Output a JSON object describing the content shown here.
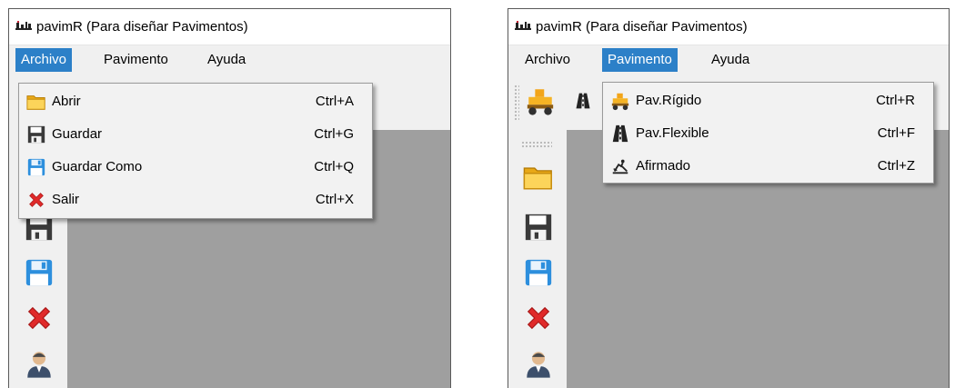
{
  "left_window": {
    "title": "pavimR (Para diseñar Pavimentos)",
    "menus": [
      {
        "label": "Archivo",
        "active": true
      },
      {
        "label": "Pavimento",
        "active": false
      },
      {
        "label": "Ayuda",
        "active": false
      }
    ],
    "dropdown": [
      {
        "label": "Abrir",
        "shortcut": "Ctrl+A",
        "icon": "folder-icon"
      },
      {
        "label": "Guardar",
        "shortcut": "Ctrl+G",
        "icon": "save-icon"
      },
      {
        "label": "Guardar Como",
        "shortcut": "Ctrl+Q",
        "icon": "save-as-icon"
      },
      {
        "label": "Salir",
        "shortcut": "Ctrl+X",
        "icon": "exit-icon"
      }
    ],
    "vertical_toolbar": [
      "save-icon",
      "save-as-icon",
      "exit-icon",
      "user-icon"
    ]
  },
  "right_window": {
    "title": "pavimR (Para diseñar Pavimentos)",
    "menus": [
      {
        "label": "Archivo",
        "active": false
      },
      {
        "label": "Pavimento",
        "active": true
      },
      {
        "label": "Ayuda",
        "active": false
      }
    ],
    "dropdown": [
      {
        "label": "Pav.Rígido",
        "shortcut": "Ctrl+R",
        "icon": "rigid-pavement-icon"
      },
      {
        "label": "Pav.Flexible",
        "shortcut": "Ctrl+F",
        "icon": "flexible-pavement-icon"
      },
      {
        "label": "Afirmado",
        "shortcut": "Ctrl+Z",
        "icon": "gravel-icon"
      }
    ],
    "horizontal_toolbar": [
      "rigid-pavement-icon",
      "flexible-pavement-icon"
    ],
    "vertical_toolbar": [
      "folder-icon",
      "save-icon",
      "save-as-icon",
      "exit-icon",
      "user-icon"
    ]
  },
  "colors": {
    "menu_highlight": "#2c80c8",
    "chrome": "#f0f0f0",
    "workspace": "#9f9f9f",
    "menu_bg": "#f2f2f2"
  }
}
